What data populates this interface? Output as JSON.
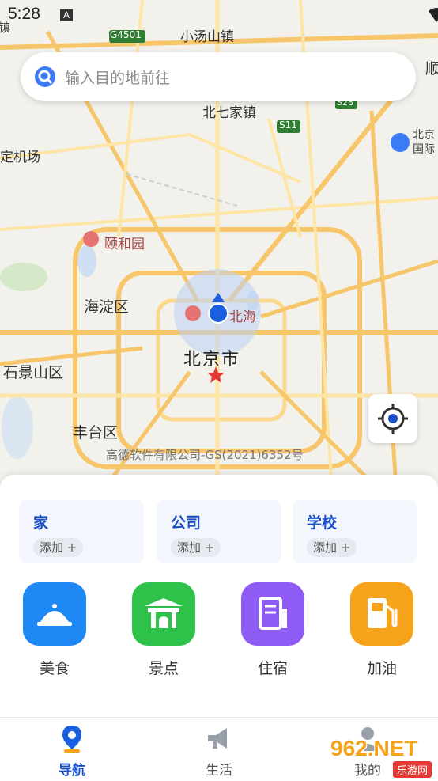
{
  "status_bar": {
    "time": "5:28",
    "notification": "A"
  },
  "search": {
    "placeholder": "输入目的地前往"
  },
  "map": {
    "labels": {
      "xiaotangshan": "小汤山镇",
      "beiqijia": "北七家镇",
      "jichang": "定机场",
      "yiheyuan": "颐和园",
      "haidian": "海淀区",
      "beihai": "北海",
      "beijing": "北京市",
      "shijingshan": "石景山区",
      "fengtai": "丰台区",
      "g4501": "G4501",
      "s11": "S11",
      "s28": "S28",
      "airport": "北京\n国际",
      "left_edge": "镇",
      "right_edge": "顺"
    },
    "copyright": "高德软件有限公司-GS(2021)6352号"
  },
  "shortcuts": [
    {
      "title": "家",
      "action": "添加 +"
    },
    {
      "title": "公司",
      "action": "添加 +"
    },
    {
      "title": "学校",
      "action": "添加 +"
    }
  ],
  "categories": [
    {
      "label": "美食",
      "icon": "food-icon",
      "color": "#1e88f5"
    },
    {
      "label": "景点",
      "icon": "scenic-icon",
      "color": "#2ec24a"
    },
    {
      "label": "住宿",
      "icon": "hotel-icon",
      "color": "#8f5bf5"
    },
    {
      "label": "加油",
      "icon": "gas-icon",
      "color": "#f7a21b"
    }
  ],
  "tabs": [
    {
      "label": "导航",
      "active": true
    },
    {
      "label": "生活",
      "active": false
    },
    {
      "label": "我的",
      "active": false
    }
  ],
  "watermark": {
    "text": "962.NET",
    "sub": "乐游网"
  },
  "colors": {
    "accent": "#1a4fc8",
    "road_major": "#f7c66a",
    "road_minor": "#fde5a6"
  }
}
